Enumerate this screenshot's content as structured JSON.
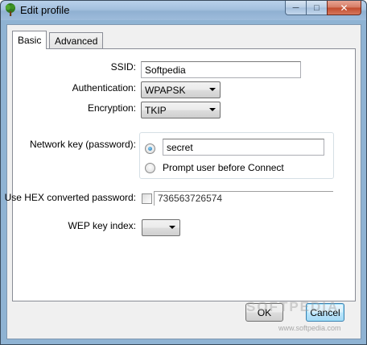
{
  "window": {
    "title": "Edit profile",
    "icon": "tree-icon",
    "controls": {
      "minimize": "─",
      "maximize": "□",
      "close": "✕"
    }
  },
  "tabs": [
    {
      "label": "Basic",
      "selected": true
    },
    {
      "label": "Advanced",
      "selected": false
    }
  ],
  "form": {
    "ssid_label": "SSID:",
    "ssid_value": "Softpedia",
    "authentication_label": "Authentication:",
    "authentication_value": "WPAPSK",
    "encryption_label": "Encryption:",
    "encryption_value": "TKIP",
    "network_key_label": "Network key (password):",
    "network_key_value": "secret",
    "prompt_option_label": "Prompt user before Connect",
    "network_key_option_selected": true,
    "hex_label": "Use HEX converted password:",
    "hex_checked": false,
    "hex_value": "736563726574",
    "wep_label": "WEP key index:",
    "wep_value": ""
  },
  "buttons": {
    "ok": "OK",
    "cancel": "Cancel"
  },
  "watermark": {
    "logo": "SOFTPEDIA",
    "url": "www.softpedia.com"
  }
}
